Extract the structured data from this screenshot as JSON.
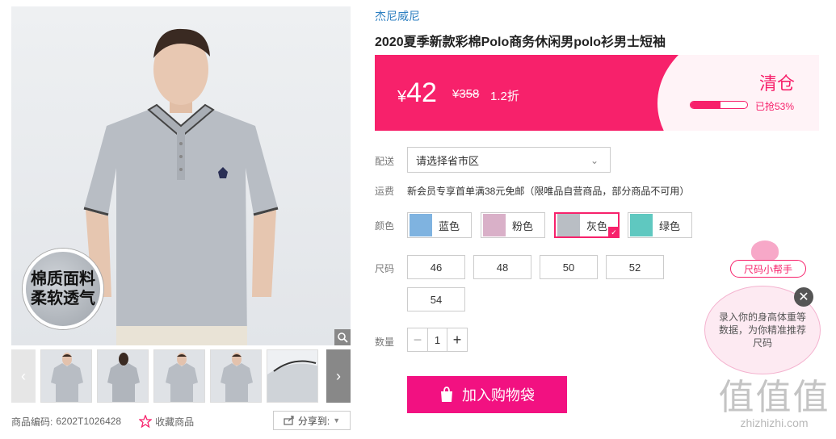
{
  "gallery": {
    "badge_line1": "棉质面料",
    "badge_line2": "柔软透气"
  },
  "meta": {
    "sku_label": "商品编码:",
    "sku_value": "6202T1026428",
    "favorite_label": "收藏商品",
    "share_label": "分享到:"
  },
  "product": {
    "brand": "杰尼威尼",
    "title": "2020夏季新款彩棉Polo商务休闲男polo衫男士短袖"
  },
  "price": {
    "currency": "¥",
    "current": "42",
    "original": "¥358",
    "discount": "1.2折",
    "clearance_label": "清仓",
    "sold_label": "已抢53%",
    "sold_fraction": 0.53
  },
  "delivery": {
    "label": "配送",
    "select_value": "请选择省市区"
  },
  "shipping": {
    "label": "运费",
    "text": "新会员专享首单满38元免邮（限唯品自营商品，部分商品不可用）"
  },
  "colors": {
    "label": "颜色",
    "options": [
      {
        "label": "蓝色",
        "swatch": "#7fb3e0"
      },
      {
        "label": "粉色",
        "swatch": "#d9b0c8"
      },
      {
        "label": "灰色",
        "swatch": "#b9bec4"
      },
      {
        "label": "绿色",
        "swatch": "#5fc8c0"
      }
    ],
    "selected": "灰色"
  },
  "sizes": {
    "label": "尺码",
    "options": [
      "46",
      "48",
      "50",
      "52",
      "54"
    ]
  },
  "quantity": {
    "label": "数量",
    "value": "1",
    "minus": "−",
    "plus": "+"
  },
  "cart": {
    "label": "加入购物袋"
  },
  "size_helper": {
    "tag": "尺码小帮手",
    "bubble_text": "录入你的身高体重等数据，为你精准推荐尺码",
    "close": "✕"
  },
  "watermark": {
    "glyphs": "值值值",
    "url": "zhizhizhi.com"
  },
  "colors_theme": {
    "accent": "#f7216b",
    "cart": "#f21181",
    "brand_link": "#2d7fc1"
  }
}
